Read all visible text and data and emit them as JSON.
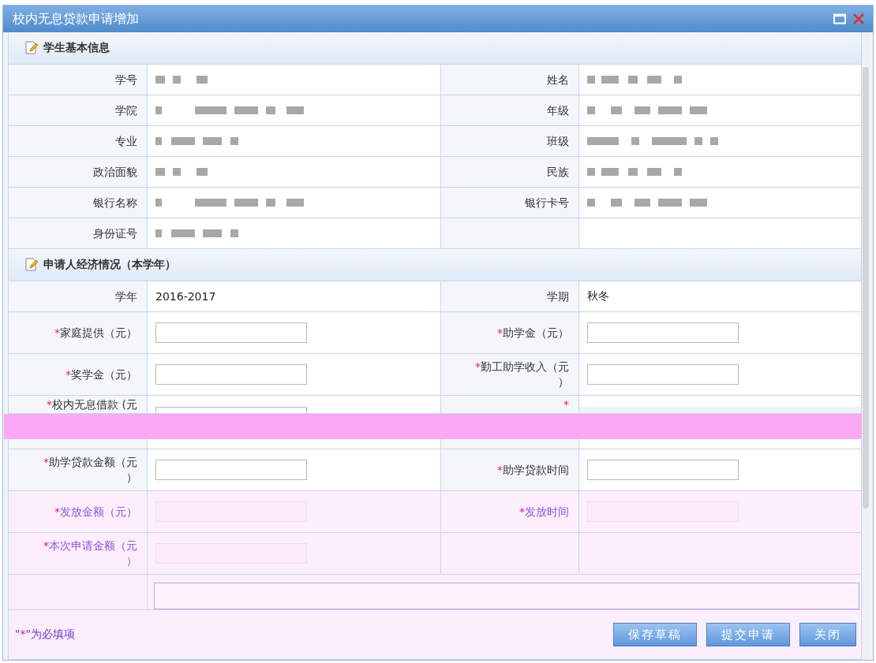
{
  "window": {
    "title": "校内无息贷款申请增加"
  },
  "sections": [
    {
      "title": "学生基本信息",
      "rows": [
        {
          "cells": [
            {
              "label": "学号",
              "kind": "redacted"
            },
            {
              "label": "姓名",
              "kind": "redacted"
            }
          ]
        },
        {
          "cells": [
            {
              "label": "学院",
              "kind": "redacted"
            },
            {
              "label": "年级",
              "kind": "redacted"
            }
          ]
        },
        {
          "cells": [
            {
              "label": "专业",
              "kind": "redacted"
            },
            {
              "label": "班级",
              "kind": "redacted"
            }
          ]
        },
        {
          "cells": [
            {
              "label": "政治面貌",
              "kind": "redacted"
            },
            {
              "label": "民族",
              "kind": "redacted"
            }
          ]
        },
        {
          "cells": [
            {
              "label": "银行名称",
              "kind": "redacted"
            },
            {
              "label": "银行卡号",
              "kind": "redacted"
            }
          ]
        },
        {
          "cells": [
            {
              "label": "身份证号",
              "kind": "redacted"
            },
            {
              "kind": "empty"
            }
          ]
        }
      ]
    },
    {
      "title": "申请人经济情况（本学年）",
      "rows": [
        {
          "cells": [
            {
              "label": "学年",
              "kind": "text",
              "value": "2016-2017"
            },
            {
              "label": "学期",
              "kind": "text",
              "value": "秋冬"
            }
          ]
        },
        {
          "cells": [
            {
              "label": "家庭提供（元）",
              "kind": "input",
              "required": true,
              "disabled": false
            },
            {
              "label": "助学金（元）",
              "kind": "input",
              "required": true,
              "disabled": false
            }
          ]
        },
        {
          "cells": [
            {
              "label": "奖学金（元）",
              "kind": "input",
              "required": true,
              "disabled": false
            },
            {
              "label": "勤工助学收入（元）",
              "kind": "input",
              "required": true,
              "disabled": false
            }
          ]
        },
        {
          "cut": true,
          "cells": [
            {
              "label": "校内无息借款 (元",
              "kind": "input",
              "required": true,
              "disabled": false
            },
            {
              "kind": "empty",
              "required": true
            }
          ]
        },
        {
          "cells": [
            {
              "label": "助学贷款金额（元）",
              "kind": "input",
              "required": true,
              "disabled": false
            },
            {
              "label": "助学贷款时间",
              "kind": "input",
              "required": true,
              "disabled": false
            }
          ]
        },
        {
          "cells": [
            {
              "label": "发放金额（元）",
              "kind": "input",
              "required": true,
              "disabled": true
            },
            {
              "label": "发放时间",
              "kind": "input",
              "required": true,
              "disabled": true
            }
          ]
        },
        {
          "cells": [
            {
              "label": "本次申请金额（元）",
              "kind": "input",
              "required": true,
              "disabled": true
            },
            {
              "kind": "empty",
              "disabled": true
            }
          ]
        }
      ]
    }
  ],
  "remark": {
    "disabled": true
  },
  "footer": {
    "note_before": "\"",
    "star": "*",
    "note_after": "\"为必填项",
    "buttons": [
      "保存草稿",
      "提交申请",
      "关闭"
    ]
  }
}
